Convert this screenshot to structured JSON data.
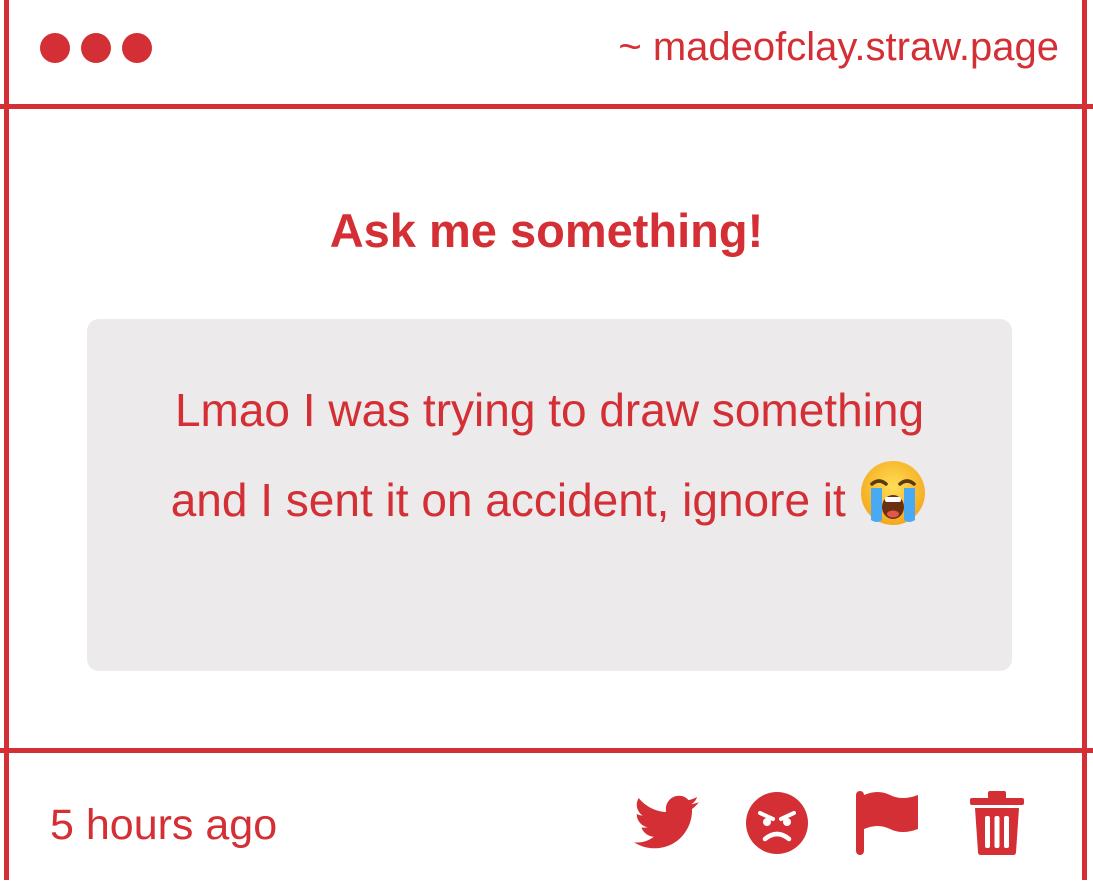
{
  "window": {
    "url": "~ madeofclay.straw.page"
  },
  "prompt": {
    "title": "Ask me something!"
  },
  "message": {
    "text": "Lmao I was trying to draw something and I sent it on accident, ignore it",
    "emoji": "loudly-crying-face-emoji"
  },
  "footer": {
    "timestamp": "5 hours ago",
    "actions": [
      "twitter-icon",
      "angry-face-icon",
      "flag-icon",
      "trash-icon"
    ]
  },
  "colors": {
    "accent": "#d32f35",
    "card_background": "#eceaeb",
    "background": "#ffffff"
  }
}
